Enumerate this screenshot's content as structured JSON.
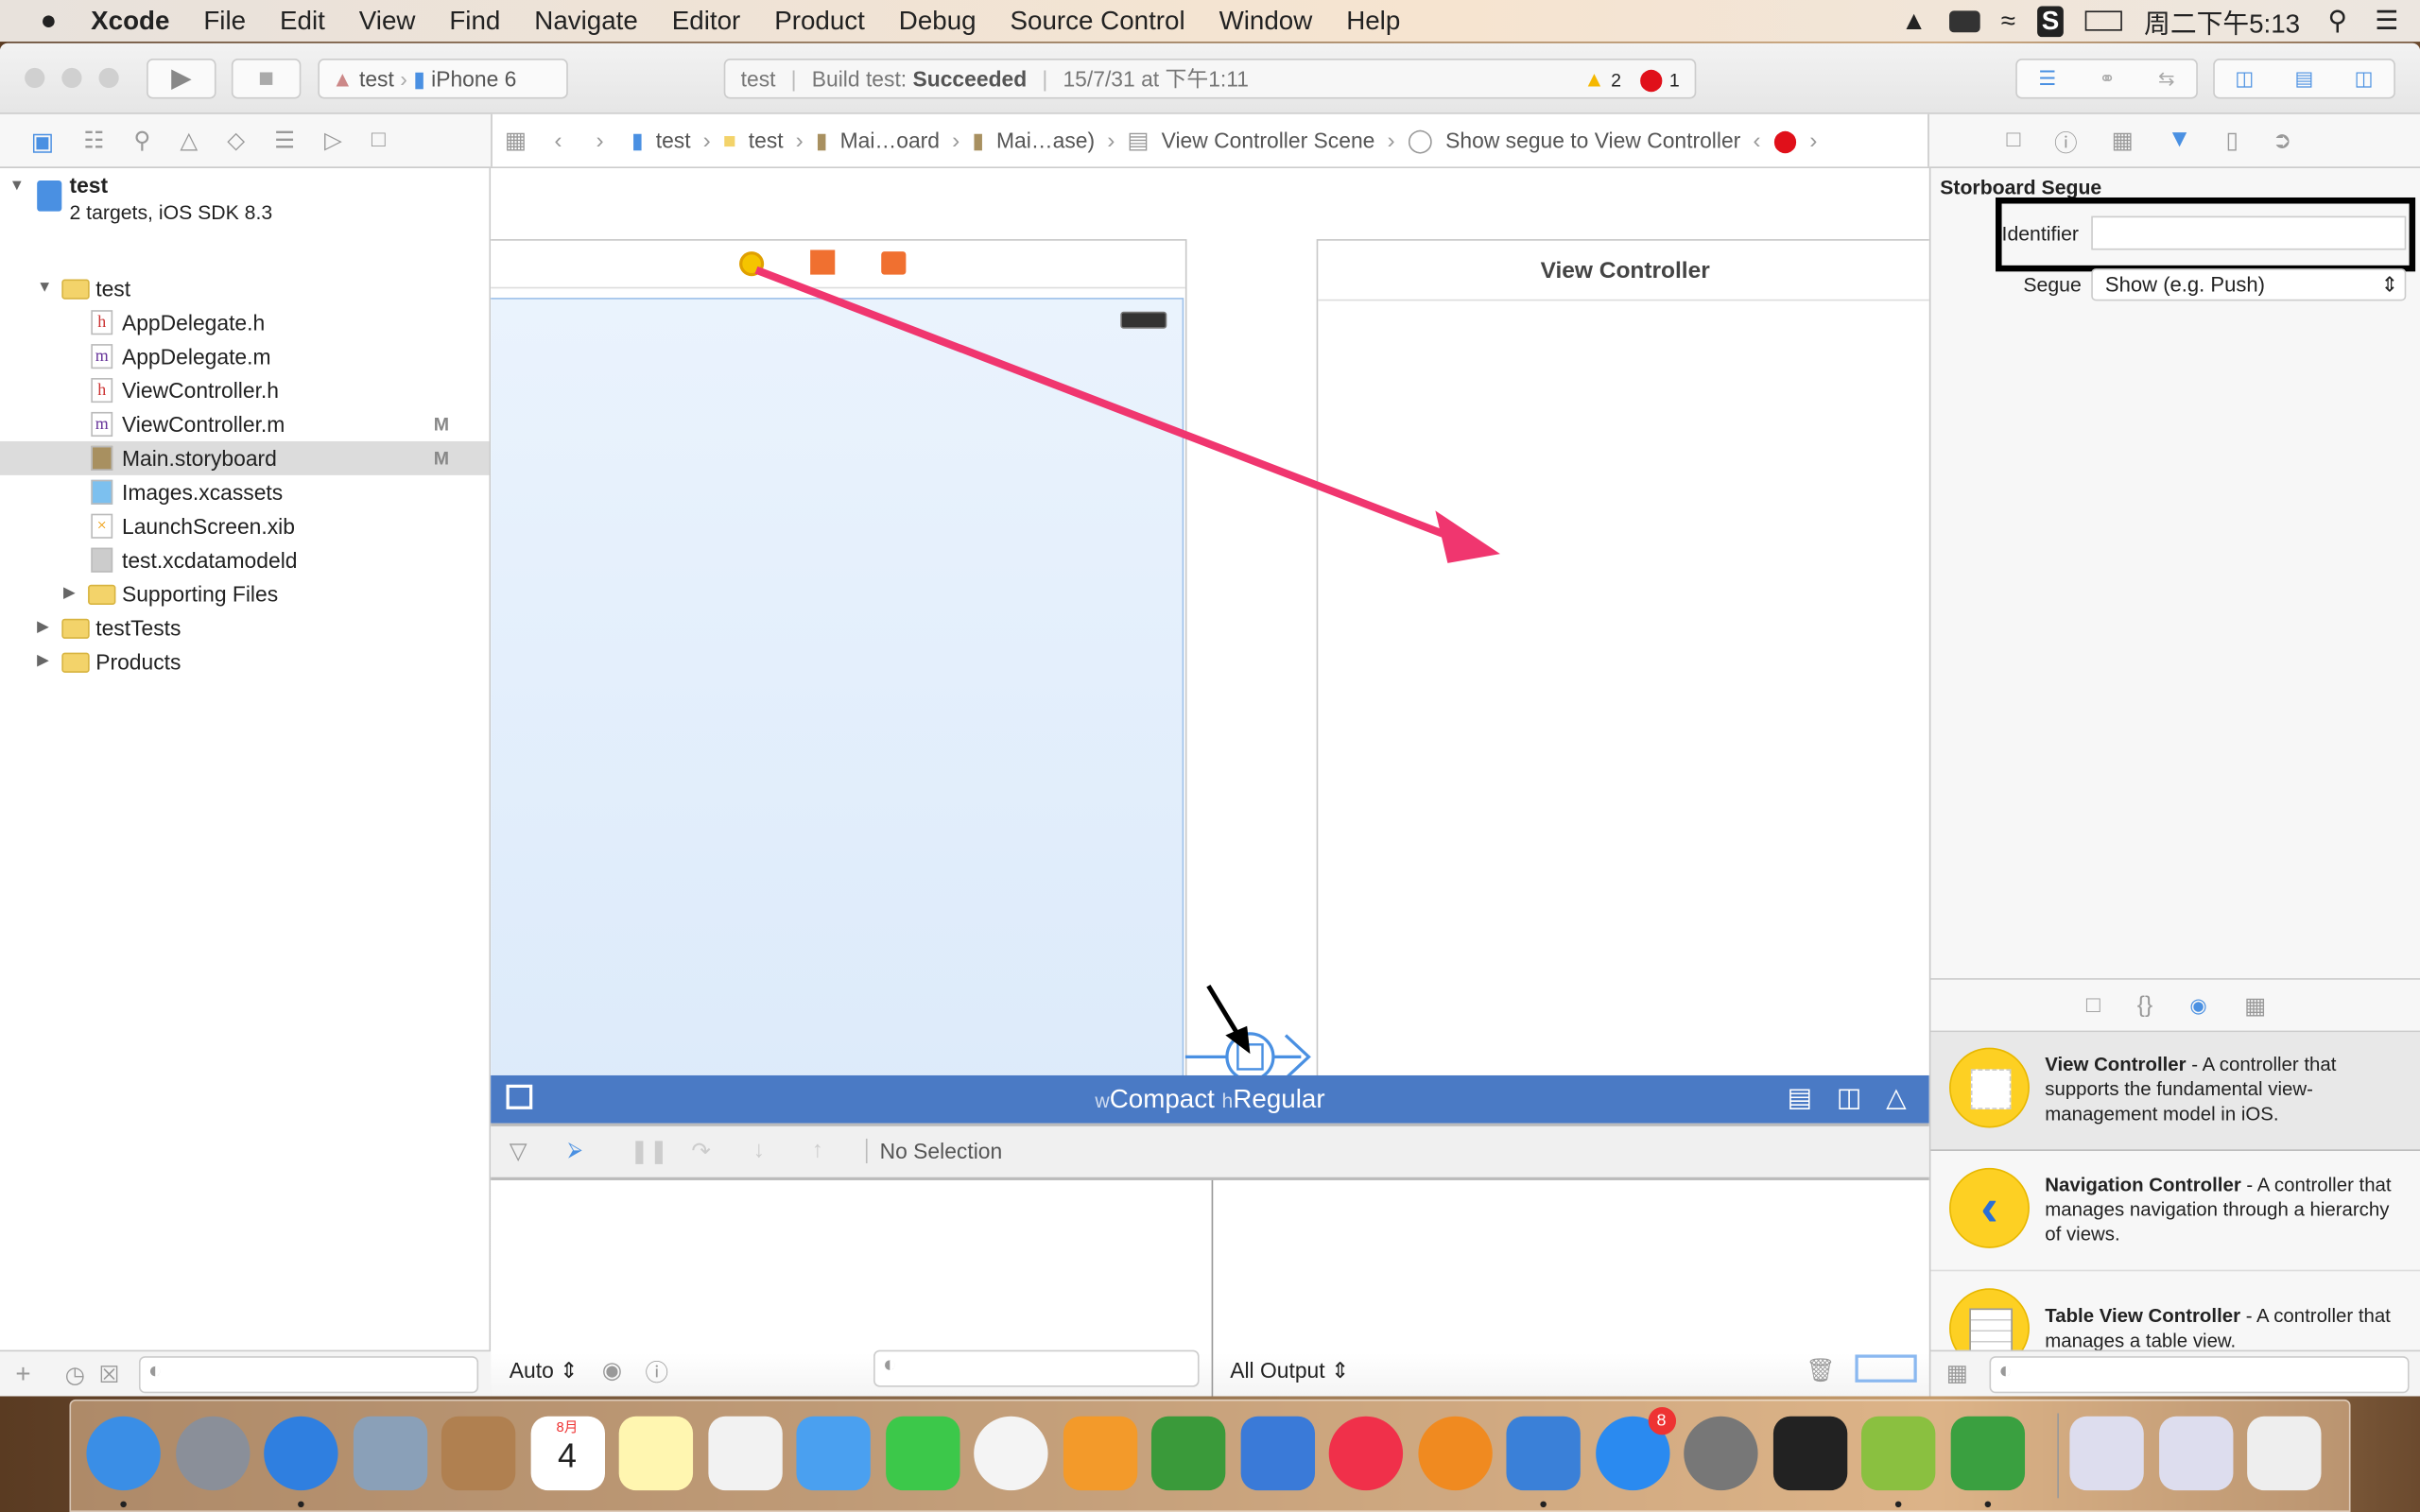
{
  "menubar": {
    "app": "Xcode",
    "items": [
      "File",
      "Edit",
      "View",
      "Find",
      "Navigate",
      "Editor",
      "Product",
      "Debug",
      "Source Control",
      "Window",
      "Help"
    ],
    "clock": "周二下午5:13"
  },
  "toolbar": {
    "scheme": "test",
    "device": "iPhone 6",
    "activity": {
      "project": "test",
      "status_prefix": "Build test:",
      "status": "Succeeded",
      "time": "15/7/31 at 下午1:11",
      "warnings": "2",
      "errors": "1"
    }
  },
  "jumpbar": {
    "crumbs": [
      "test",
      "test",
      "Mai…oard",
      "Mai…ase)",
      "View Controller Scene",
      "Show segue to View Controller"
    ]
  },
  "navigator": {
    "project": {
      "name": "test",
      "subtitle": "2 targets, iOS SDK 8.3"
    },
    "items": [
      {
        "label": "test",
        "type": "folder",
        "indent": 1,
        "expanded": true
      },
      {
        "label": "AppDelegate.h",
        "type": "h",
        "indent": 2,
        "badge": ""
      },
      {
        "label": "AppDelegate.m",
        "type": "m",
        "indent": 2,
        "badge": ""
      },
      {
        "label": "ViewController.h",
        "type": "h",
        "indent": 2,
        "badge": ""
      },
      {
        "label": "ViewController.m",
        "type": "m",
        "indent": 2,
        "badge": "M"
      },
      {
        "label": "Main.storyboard",
        "type": "sb",
        "indent": 2,
        "badge": "M",
        "selected": true
      },
      {
        "label": "Images.xcassets",
        "type": "assets",
        "indent": 2,
        "badge": ""
      },
      {
        "label": "LaunchScreen.xib",
        "type": "xib",
        "indent": 2,
        "badge": ""
      },
      {
        "label": "test.xcdatamodeld",
        "type": "data",
        "indent": 2,
        "badge": ""
      },
      {
        "label": "Supporting Files",
        "type": "folder",
        "indent": 2,
        "expanded": false
      },
      {
        "label": "testTests",
        "type": "folder",
        "indent": 1,
        "expanded": false
      },
      {
        "label": "Products",
        "type": "folder",
        "indent": 1,
        "expanded": false
      }
    ]
  },
  "canvas": {
    "right_scene_title": "View Controller",
    "size_class": {
      "w": "w",
      "w_value": "Compact",
      "h": "h",
      "h_value": "Regular"
    },
    "arrow_color": "#f0366f"
  },
  "debug": {
    "status": "No Selection",
    "variables_mode": "Auto",
    "output_mode": "All Output"
  },
  "inspector": {
    "section": "Storboard Segue",
    "identifier_label": "Identifier",
    "identifier_value": "",
    "segue_label": "Segue",
    "segue_value": "Show (e.g. Push)"
  },
  "library": [
    {
      "title": "View Controller",
      "desc": " - A controller that supports the fundamental view-management model in iOS."
    },
    {
      "title": "Navigation Controller",
      "desc": " - A controller that manages navigation through a hierarchy of views."
    },
    {
      "title": "Table View Controller",
      "desc": " - A controller that manages a table view."
    }
  ],
  "dock": {
    "calendar_month": "8月",
    "calendar_day": "4",
    "appstore_badge": "8",
    "apps": [
      "finder",
      "launchpad",
      "safari",
      "preview",
      "contacts",
      "calendar",
      "notes",
      "reminders",
      "messages",
      "facetime",
      "photos",
      "pages",
      "numbers",
      "keynote",
      "itunes",
      "ibooks",
      "xcode",
      "app-store",
      "system-preferences",
      "activity-monitor",
      "android-studio",
      "evernote",
      "window-1",
      "window-2",
      "trash"
    ]
  },
  "colors": {
    "accent": "#4a7ac5",
    "selection": "#dcdcdc",
    "warning": "#f5b800",
    "error": "#e0101a"
  }
}
